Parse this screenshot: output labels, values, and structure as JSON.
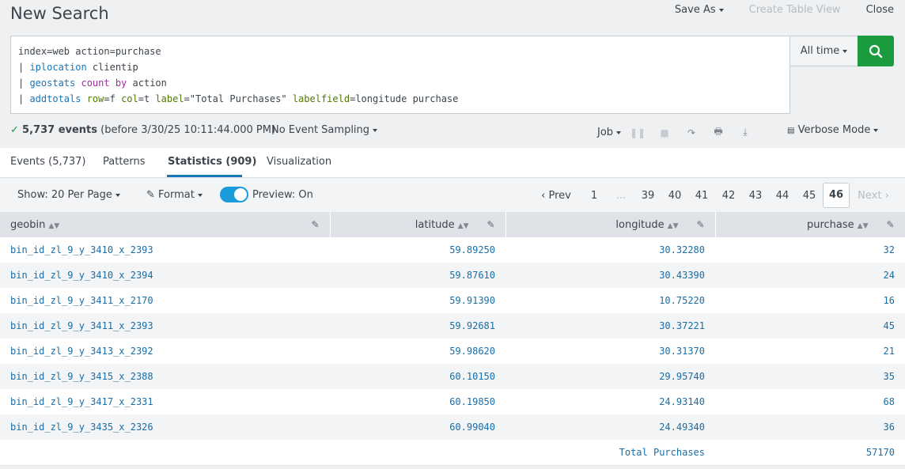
{
  "header": {
    "title": "New Search",
    "save_as": "Save As",
    "create_table_view": "Create Table View",
    "close": "Close"
  },
  "search": {
    "line1": "index=web action=purchase",
    "line2_pipe": "| ",
    "line2_cmd": "iplocation",
    "line2_rest": " clientip",
    "line3_pipe": "| ",
    "line3_cmd": "geostats",
    "line3_fn": " count",
    "line3_by": " by",
    "line3_rest": " action",
    "line4_pipe": "| ",
    "line4_cmd": "addtotals",
    "line4_a1": " row",
    "line4_v1": "=f",
    "line4_a2": " col",
    "line4_v2": "=t",
    "line4_a3": " label",
    "line4_v3": "=\"Total Purchases\"",
    "line4_a4": " labelfield",
    "line4_v4": "=longitude purchase",
    "time_range": "All time"
  },
  "status": {
    "check": "✓",
    "events_count": "5,737 events",
    "events_detail": " (before 3/30/25 10:11:44.000 PM)",
    "sampling": "No Event Sampling",
    "job": "Job",
    "mode": "Verbose Mode"
  },
  "tabs": [
    {
      "label": "Events (5,737)"
    },
    {
      "label": "Patterns"
    },
    {
      "label": "Statistics (909)"
    },
    {
      "label": "Visualization"
    }
  ],
  "toolbar": {
    "per_page": "Show: 20 Per Page",
    "format": "Format",
    "preview": "Preview: On"
  },
  "pager": {
    "prev": "Prev",
    "first": "1",
    "ellipsis": "...",
    "pages": [
      "39",
      "40",
      "41",
      "42",
      "43",
      "44",
      "45"
    ],
    "current": "46",
    "next": "Next"
  },
  "table": {
    "columns": [
      "geobin",
      "latitude",
      "longitude",
      "purchase"
    ],
    "rows": [
      [
        "bin_id_zl_9_y_3410_x_2393",
        "59.89250",
        "30.32280",
        "32"
      ],
      [
        "bin_id_zl_9_y_3410_x_2394",
        "59.87610",
        "30.43390",
        "24"
      ],
      [
        "bin_id_zl_9_y_3411_x_2170",
        "59.91390",
        "10.75220",
        "16"
      ],
      [
        "bin_id_zl_9_y_3411_x_2393",
        "59.92681",
        "30.37221",
        "45"
      ],
      [
        "bin_id_zl_9_y_3413_x_2392",
        "59.98620",
        "30.31370",
        "21"
      ],
      [
        "bin_id_zl_9_y_3415_x_2388",
        "60.10150",
        "29.95740",
        "35"
      ],
      [
        "bin_id_zl_9_y_3417_x_2331",
        "60.19850",
        "24.93140",
        "68"
      ],
      [
        "bin_id_zl_9_y_3435_x_2326",
        "60.99040",
        "24.49340",
        "36"
      ]
    ],
    "total_label": "Total Purchases",
    "total_value": "57170"
  },
  "colors": {
    "accent": "#1a75b8",
    "search_button": "#1a9c3e",
    "toggle": "#1a9cdb"
  }
}
